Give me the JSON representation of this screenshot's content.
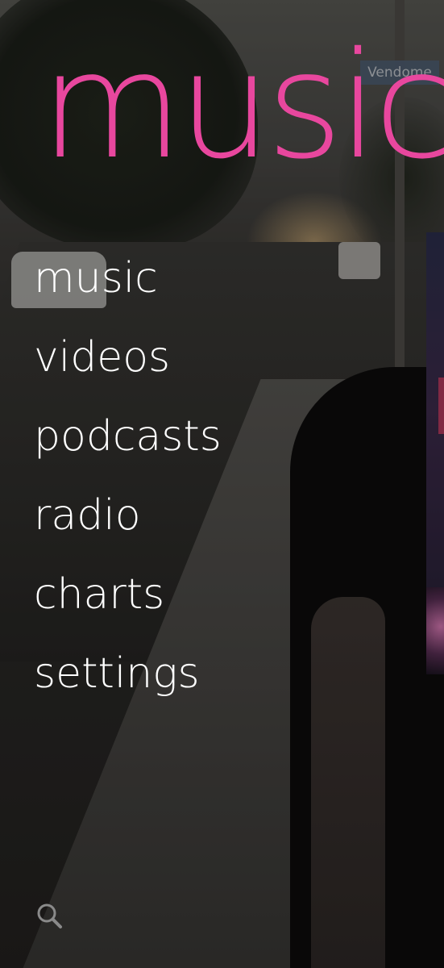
{
  "app": {
    "title": "music",
    "accent_color": "#e8479e"
  },
  "background": {
    "street_sign_text": "Vendome"
  },
  "menu": {
    "items": [
      {
        "label": "music"
      },
      {
        "label": "videos"
      },
      {
        "label": "podcasts"
      },
      {
        "label": "radio"
      },
      {
        "label": "charts"
      },
      {
        "label": "settings"
      }
    ]
  },
  "footer": {
    "search_icon": "search-icon"
  }
}
